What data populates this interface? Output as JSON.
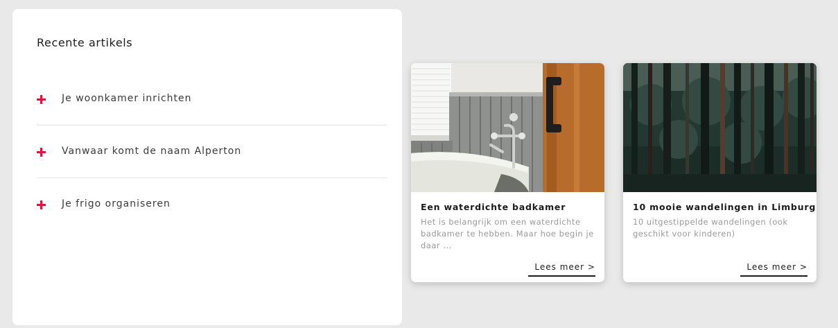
{
  "recent": {
    "title": "Recente artikels",
    "items": [
      {
        "label": "Je woonkamer inrichten"
      },
      {
        "label": "Vanwaar komt de naam Alperton"
      },
      {
        "label": "Je frigo organiseren"
      }
    ]
  },
  "cards": [
    {
      "title": "Een waterdichte badkamer",
      "description": "Het is belangrijk om een waterdichte badkamer te hebben. Maar hoe begin je daar ...",
      "link": "Lees meer >",
      "image": "bathroom-photo"
    },
    {
      "title": "10 mooie wandelingen in Limburg",
      "description": "10 uitgestippelde wandelingen (ook geschikt voor kinderen)",
      "link": "Lees meer >",
      "image": "forest-photo"
    }
  ],
  "colors": {
    "accent": "#e0153d",
    "background": "#e9e9e9"
  }
}
